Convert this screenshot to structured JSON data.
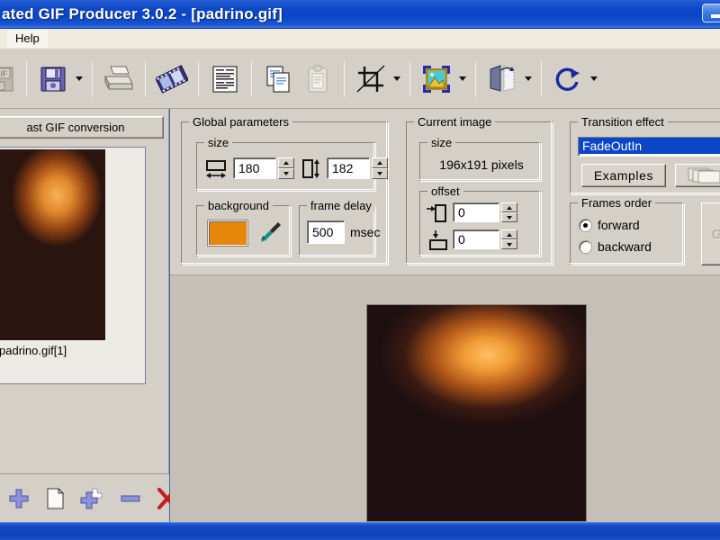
{
  "window": {
    "title": "ated GIF Producer 3.0.2 - [padrino.gif]",
    "minimize_label": "Minimize"
  },
  "menu": {
    "items": [
      {
        "label": "Help",
        "name": "menu-help"
      }
    ]
  },
  "toolbar": {
    "buttons": [
      {
        "name": "open-gif-button",
        "icon": "gif-open-icon",
        "label": "GIF",
        "disabled": true,
        "dropdown": false
      },
      {
        "name": "save-button",
        "icon": "floppy-save-icon",
        "label": "Save",
        "disabled": false,
        "dropdown": true
      },
      {
        "name": "print-button",
        "icon": "printer-icon",
        "label": "Print",
        "disabled": false,
        "dropdown": false
      },
      {
        "name": "filmstrip-button",
        "icon": "filmstrip-icon",
        "label": "Film strip",
        "disabled": false,
        "dropdown": false
      },
      {
        "name": "properties-button",
        "icon": "document-list-icon",
        "label": "Properties",
        "disabled": false,
        "dropdown": false
      },
      {
        "name": "copy-button",
        "icon": "copy-icon",
        "label": "Copy",
        "disabled": false,
        "dropdown": false
      },
      {
        "name": "paste-button",
        "icon": "clipboard-paste-icon",
        "label": "Paste",
        "disabled": true,
        "dropdown": false
      },
      {
        "name": "crop-button",
        "icon": "crop-icon",
        "label": "Crop",
        "disabled": false,
        "dropdown": true
      },
      {
        "name": "resize-image-button",
        "icon": "picture-icon",
        "label": "Resize image",
        "disabled": false,
        "dropdown": true
      },
      {
        "name": "flip-button",
        "icon": "flip-icon",
        "label": "Flip",
        "disabled": false,
        "dropdown": true
      },
      {
        "name": "rotate-button",
        "icon": "rotate-icon",
        "label": "Rotate",
        "disabled": false,
        "dropdown": true
      }
    ]
  },
  "left_panel": {
    "fast_gif_button": "ast GIF conversion",
    "frames": [
      {
        "label": "padrino.gif[1]",
        "selected": true
      }
    ],
    "actions": [
      {
        "name": "add-frame-button",
        "icon": "plus-icon",
        "label": "Add frame"
      },
      {
        "name": "new-frame-button",
        "icon": "page-icon",
        "label": "New frame"
      },
      {
        "name": "insert-frames-button",
        "icon": "multi-plus-icon",
        "label": "Insert frames"
      },
      {
        "name": "remove-frame-button",
        "icon": "minus-icon",
        "label": "Remove frame"
      },
      {
        "name": "delete-all-button",
        "icon": "red-x-icon",
        "label": "Delete all"
      }
    ]
  },
  "global_parameters": {
    "title": "Global parameters",
    "size": {
      "title": "size",
      "width": "180",
      "height": "182"
    },
    "background": {
      "title": "background",
      "color": "#e8860b",
      "picker_icon": "eyedropper-icon"
    },
    "frame_delay": {
      "title": "frame delay",
      "value": "500",
      "unit": "msec"
    }
  },
  "current_image": {
    "title": "Current image",
    "size": {
      "title": "size",
      "value": "196x191 pixels"
    },
    "offset": {
      "title": "offset",
      "x": "0",
      "y": "0"
    }
  },
  "transition_effect": {
    "title": "Transition effect",
    "selected": "FadeOutIn",
    "examples_button": "Examples",
    "frames_stack_button": "frames-stack-icon"
  },
  "frames_order": {
    "title": "Frames order",
    "options": [
      {
        "label": "forward",
        "selected": true
      },
      {
        "label": "backward",
        "selected": false
      }
    ],
    "gif_ghost_label": "GIF"
  }
}
